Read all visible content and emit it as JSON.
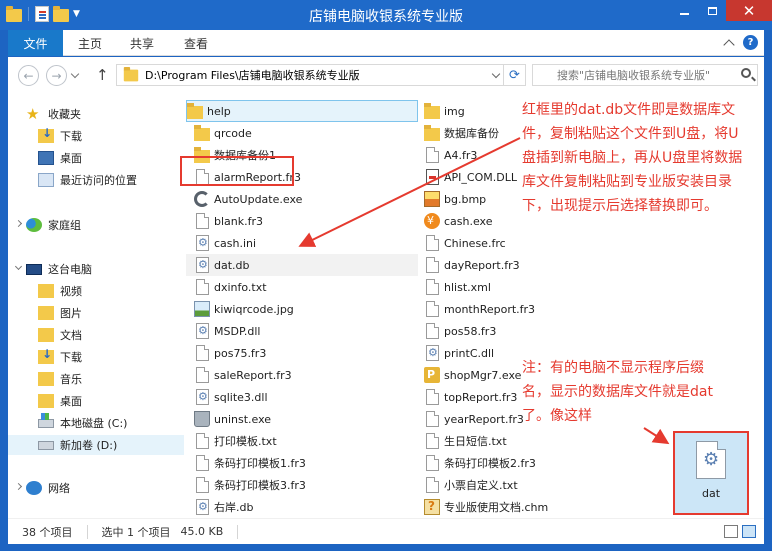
{
  "window": {
    "title": "店铺电脑收银系统专业版",
    "min_label": "",
    "max_label": "",
    "close_label": "✕"
  },
  "ribbon": {
    "file_tab": "文件",
    "tabs": [
      "主页",
      "共享",
      "查看"
    ]
  },
  "address": {
    "path": "D:\\Program Files\\店铺电脑收银系统专业版",
    "search_placeholder": "搜索\"店铺电脑收银系统专业版\""
  },
  "navpane": {
    "favorites": "收藏夹",
    "fav_items": [
      "下载",
      "桌面",
      "最近访问的位置"
    ],
    "homegroup": "家庭组",
    "this_pc": "这台电脑",
    "pc_items": [
      "视频",
      "图片",
      "文档",
      "下载",
      "音乐",
      "桌面",
      "本地磁盘 (C:)",
      "新加卷 (D:)"
    ],
    "network": "网络"
  },
  "files_col1": [
    "help",
    "qrcode",
    "数据库备份1",
    "alarmReport.fr3",
    "AutoUpdate.exe",
    "blank.fr3",
    "cash.ini",
    "dat.db",
    "dxinfo.txt",
    "kiwiqrcode.jpg",
    "MSDP.dll",
    "pos75.fr3",
    "saleReport.fr3",
    "sqlite3.dll",
    "uninst.exe",
    "打印模板.txt",
    "条码打印模板1.fr3",
    "条码打印模板3.fr3",
    "右岸.db"
  ],
  "files_col2": [
    "img",
    "数据库备份",
    "A4.fr3",
    "API_COM.DLL",
    "bg.bmp",
    "cash.exe",
    "Chinese.frc",
    "dayReport.fr3",
    "hlist.xml",
    "monthReport.fr3",
    "pos58.fr3",
    "printC.dll",
    "shopMgr7.exe",
    "topReport.fr3",
    "yearReport.fr3",
    "生日短信.txt",
    "条码打印模板2.fr3",
    "小票自定义.txt",
    "专业版使用文档.chm"
  ],
  "annotations": {
    "main": "红框里的dat.db文件即是数据库文件，复制粘贴这个文件到U盘，将U盘插到新电脑上，再从U盘里将数据库文件复制粘贴到专业版安装目录下，出现提示后选择替换即可。",
    "note": "注：有的电脑不显示程序后缀名，显示的数据库文件就是dat了。像这样",
    "tile_label": "dat"
  },
  "status": {
    "count": "38 个项目",
    "selection": "选中 1 个项目",
    "size": "45.0 KB"
  },
  "colors": {
    "accent": "#1f6ac9",
    "annotation_red": "#e53a2f"
  }
}
